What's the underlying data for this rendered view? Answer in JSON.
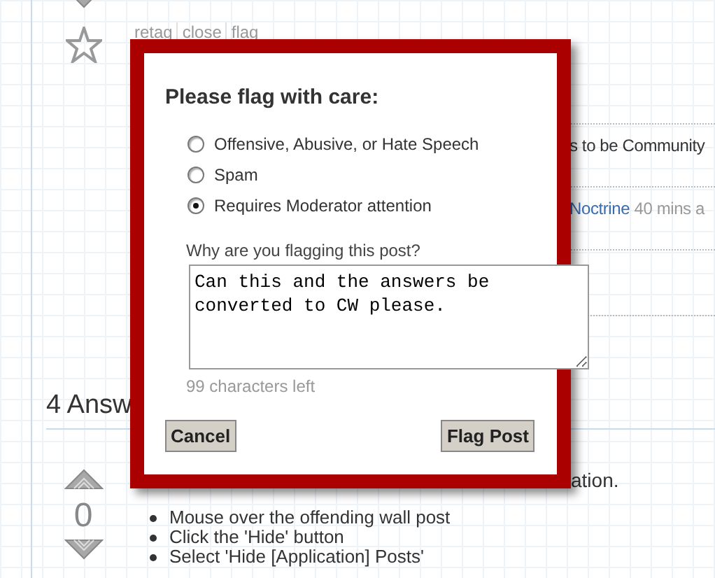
{
  "question": {
    "links": [
      "retag",
      "close",
      "flag"
    ],
    "comments": [
      {
        "text": "s to be Community"
      },
      {
        "author": "Noctrine",
        "time": "40 mins a"
      }
    ]
  },
  "answers_heading": "4 Answ",
  "answer": {
    "votes": "0",
    "text_fragment": "ation.",
    "steps": [
      "Mouse over the offending wall post",
      "Click the 'Hide' button",
      "Select 'Hide [Application] Posts'"
    ]
  },
  "dialog": {
    "title": "Please flag with care:",
    "options": [
      {
        "label": "Offensive, Abusive, or Hate Speech",
        "selected": false
      },
      {
        "label": "Spam",
        "selected": false
      },
      {
        "label": "Requires Moderator attention",
        "selected": true
      }
    ],
    "reason_label": "Why are you flagging this post?",
    "reason_value": "Can this and the answers be converted to CW please.",
    "chars_left": "99 characters left",
    "buttons": [
      "Cancel",
      "Flag Post"
    ]
  }
}
